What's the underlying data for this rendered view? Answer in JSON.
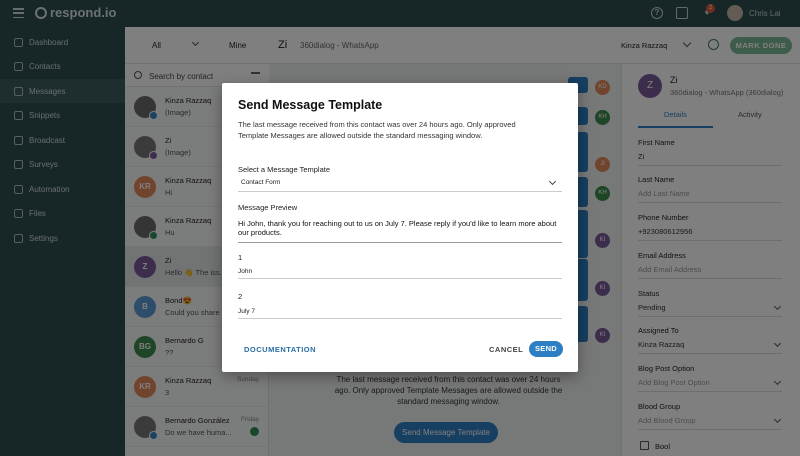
{
  "topbar": {
    "logo": "respond.io",
    "notifications_count": "2",
    "user_name": "Chris Lai"
  },
  "sidebar": {
    "items": [
      {
        "label": "Dashboard",
        "icon": "dashboard-icon"
      },
      {
        "label": "Contacts",
        "icon": "contacts-icon"
      },
      {
        "label": "Messages",
        "icon": "messages-icon"
      },
      {
        "label": "Snippets",
        "icon": "snippets-icon"
      },
      {
        "label": "Broadcast",
        "icon": "broadcast-icon"
      },
      {
        "label": "Surveys",
        "icon": "surveys-icon"
      },
      {
        "label": "Automation",
        "icon": "automation-icon"
      },
      {
        "label": "Files",
        "icon": "files-icon"
      },
      {
        "label": "Settings",
        "icon": "settings-icon"
      }
    ]
  },
  "conversations": {
    "tab_all": "All",
    "tab_mine": "Mine",
    "search_placeholder": "Search by contact",
    "items": [
      {
        "name": "Kinza Razzaq",
        "preview": "(Image)",
        "initials": "",
        "color": "#6b6b6b",
        "time": ""
      },
      {
        "name": "Zi",
        "preview": "(Image)",
        "initials": "",
        "color": "#777777",
        "time": ""
      },
      {
        "name": "Kinza Razzaq",
        "preview": "Hi",
        "initials": "KR",
        "color": "#e0885a",
        "time": ""
      },
      {
        "name": "Kinza Razzaq",
        "preview": "Hu",
        "initials": "",
        "color": "#6b6b6b",
        "time": ""
      },
      {
        "name": "Zi",
        "preview": "Hello 👋 The iss...",
        "initials": "Z",
        "color": "#7a5a9a",
        "time": ""
      },
      {
        "name": "Bond😍",
        "preview": "Could you share ...",
        "initials": "B",
        "color": "#5b9bd5",
        "time": ""
      },
      {
        "name": "Bernardo G",
        "preview": "??",
        "initials": "BG",
        "color": "#3e8a4f",
        "time": ""
      },
      {
        "name": "Kinza Razzaq",
        "preview": "3",
        "initials": "KR",
        "color": "#e0885a",
        "time": "Sunday"
      },
      {
        "name": "Bernardo González",
        "preview": "Do we have huma...",
        "initials": "",
        "color": "#777777",
        "time": "Friday"
      }
    ]
  },
  "chat": {
    "contact_name": "Zi",
    "channel": "360dialog - WhatsApp",
    "assignee": "Kinza Razzaq",
    "mark_done": "MARK DONE",
    "notice": "The last message received from this contact was over 24 hours ago. Only approved Template Messages are allowed outside the standard messaging window.",
    "send_template_button": "Send Message Template",
    "message_avatars": [
      {
        "initials": "KD",
        "color": "#e0885a"
      },
      {
        "initials": "KH",
        "color": "#3e8a4f"
      },
      {
        "initials": "JI",
        "color": "#e0885a"
      },
      {
        "initials": "KH",
        "color": "#3e8a4f"
      },
      {
        "initials": "KI",
        "color": "#7a5a9a"
      },
      {
        "initials": "KI",
        "color": "#7a5a9a"
      },
      {
        "initials": "KI",
        "color": "#7a5a9a"
      }
    ]
  },
  "details": {
    "avatar_initial": "Z",
    "name": "Zi",
    "channel": "360dialog - WhatsApp (360dialog)",
    "tab_details": "Details",
    "tab_activity": "Activity",
    "fields": [
      {
        "label": "First Name",
        "value": "Zi",
        "placeholder": false
      },
      {
        "label": "Last Name",
        "value": "Add Last Name",
        "placeholder": true
      },
      {
        "label": "Phone Number",
        "value": "+923080612956",
        "placeholder": false
      },
      {
        "label": "Email Address",
        "value": "Add Email Address",
        "placeholder": true
      },
      {
        "label": "Status",
        "value": "Pending",
        "placeholder": false
      },
      {
        "label": "Assigned To",
        "value": "Kinza Razzaq",
        "placeholder": false
      },
      {
        "label": "Blog Post Option",
        "value": "Add Blog Post Option",
        "placeholder": true
      },
      {
        "label": "Blood Group",
        "value": "Add Blood Group",
        "placeholder": true
      }
    ],
    "checkbox_label": "Bool"
  },
  "modal": {
    "title": "Send Message Template",
    "description": "The last message received from this contact was over 24 hours ago. Only approved Template Messages are allowed outside the standard messaging window.",
    "select_label": "Select a Message Template",
    "selected_template": "Contact Form",
    "preview_label": "Message Preview",
    "preview_text": "Hi John, thank you for reaching out to us on July 7. Please reply if you'd like to learn more about our products.",
    "param1_label": "1",
    "param1_value": "John",
    "param2_label": "2",
    "param2_value": "July 7",
    "documentation": "DOCUMENTATION",
    "cancel": "CANCEL",
    "send": "SEND"
  }
}
